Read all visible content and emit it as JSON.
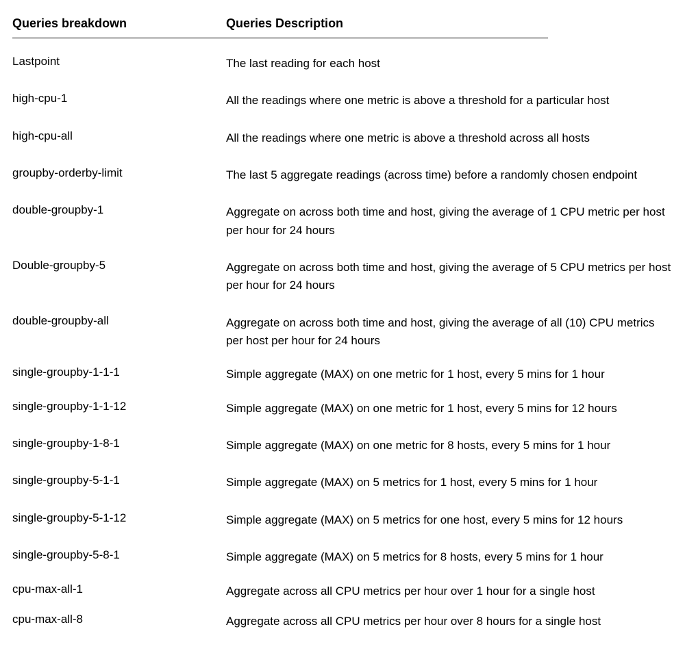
{
  "table": {
    "headers": {
      "breakdown": "Queries breakdown",
      "description": "Queries Description"
    },
    "rows": [
      {
        "breakdown": "Lastpoint",
        "description": "The last reading for each host"
      },
      {
        "breakdown": "high-cpu-1",
        "description": "All the readings where one metric is above a threshold for a particular host"
      },
      {
        "breakdown": "high-cpu-all",
        "description": "All the readings where one metric is above a threshold across all hosts"
      },
      {
        "breakdown": "groupby-orderby-limit",
        "description": "The last 5 aggregate readings (across time) before a randomly chosen endpoint"
      },
      {
        "breakdown": "double-groupby-1",
        "description": "Aggregate on across both time and host, giving the average of 1 CPU metric per host per hour for 24 hours"
      },
      {
        "breakdown": "Double-groupby-5",
        "description": "Aggregate on across both time and host, giving the average of 5 CPU metrics per host per hour for 24 hours"
      },
      {
        "breakdown": "double-groupby-all",
        "description": "Aggregate on across both time and host, giving the average of all (10) CPU metrics  per host per hour for 24 hours"
      },
      {
        "breakdown": "single-groupby-1-1-1",
        "description": "Simple aggregate (MAX) on one metric for 1 host, every 5 mins for 1 hour",
        "tight": true
      },
      {
        "breakdown": "single-groupby-1-1-12",
        "description": "Simple aggregate (MAX) on one metric for 1 host, every 5 mins for 12 hours"
      },
      {
        "breakdown": "single-groupby-1-8-1",
        "description": "Simple aggregate (MAX) on one metric for 8 hosts, every 5 mins for 1 hour"
      },
      {
        "breakdown": "single-groupby-5-1-1",
        "description": "Simple aggregate (MAX) on 5 metrics for 1 host, every 5 mins for 1 hour"
      },
      {
        "breakdown": "single-groupby-5-1-12",
        "description": "Simple aggregate (MAX) on 5 metrics for one host, every 5 mins for 12 hours"
      },
      {
        "breakdown": "single-groupby-5-8-1",
        "description": "Simple aggregate (MAX) on 5 metrics for 8 hosts, every 5 mins for 1 hour"
      },
      {
        "breakdown": "cpu-max-all-1",
        "description": "Aggregate across all CPU metrics per hour over 1 hour for a single host",
        "tight": true
      },
      {
        "breakdown": "cpu-max-all-8",
        "description": "Aggregate across all CPU metrics per hour over 8 hours for a single host",
        "tight": true
      }
    ]
  }
}
